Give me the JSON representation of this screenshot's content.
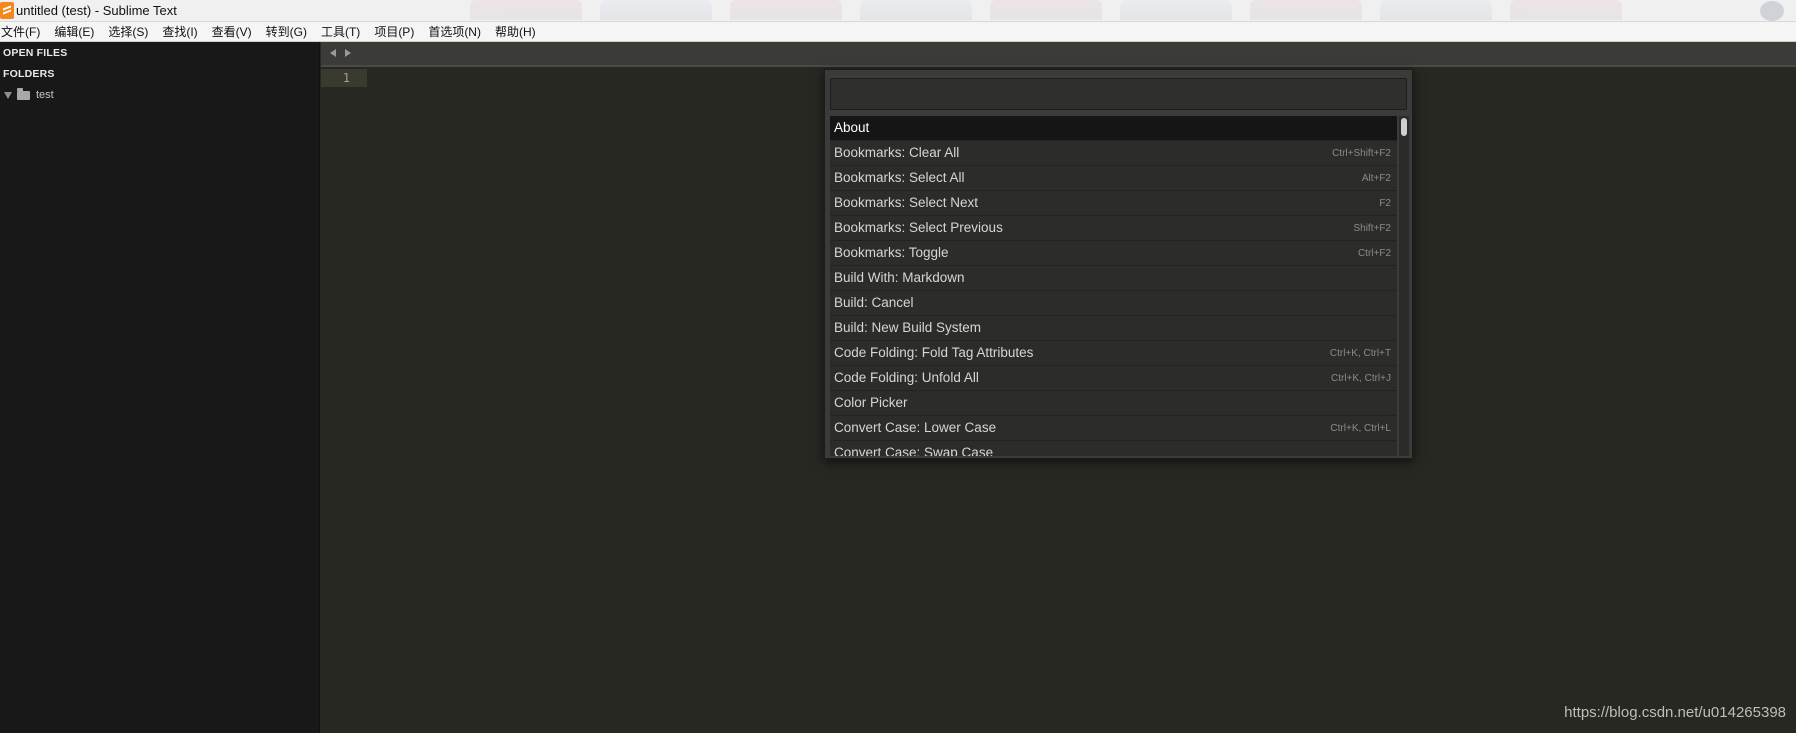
{
  "window": {
    "title": "untitled (test) - Sublime Text"
  },
  "menubar": {
    "items": [
      "文件(F)",
      "编辑(E)",
      "选择(S)",
      "查找(I)",
      "查看(V)",
      "转到(G)",
      "工具(T)",
      "项目(P)",
      "首选项(N)",
      "帮助(H)"
    ]
  },
  "sidebar": {
    "open_files_label": "OPEN FILES",
    "folders_label": "FOLDERS",
    "folder_name": "test"
  },
  "editor": {
    "line_number": "1"
  },
  "palette": {
    "query": "",
    "items": [
      {
        "label": "About",
        "shortcut": ""
      },
      {
        "label": "Bookmarks: Clear All",
        "shortcut": "Ctrl+Shift+F2"
      },
      {
        "label": "Bookmarks: Select All",
        "shortcut": "Alt+F2"
      },
      {
        "label": "Bookmarks: Select Next",
        "shortcut": "F2"
      },
      {
        "label": "Bookmarks: Select Previous",
        "shortcut": "Shift+F2"
      },
      {
        "label": "Bookmarks: Toggle",
        "shortcut": "Ctrl+F2"
      },
      {
        "label": "Build With: Markdown",
        "shortcut": ""
      },
      {
        "label": "Build: Cancel",
        "shortcut": ""
      },
      {
        "label": "Build: New Build System",
        "shortcut": ""
      },
      {
        "label": "Code Folding: Fold Tag Attributes",
        "shortcut": "Ctrl+K, Ctrl+T"
      },
      {
        "label": "Code Folding: Unfold All",
        "shortcut": "Ctrl+K, Ctrl+J"
      },
      {
        "label": "Color Picker",
        "shortcut": ""
      },
      {
        "label": "Convert Case: Lower Case",
        "shortcut": "Ctrl+K, Ctrl+L"
      },
      {
        "label": "Convert Case: Swap Case",
        "shortcut": ""
      }
    ]
  },
  "watermark": "https://blog.csdn.net/u014265398"
}
